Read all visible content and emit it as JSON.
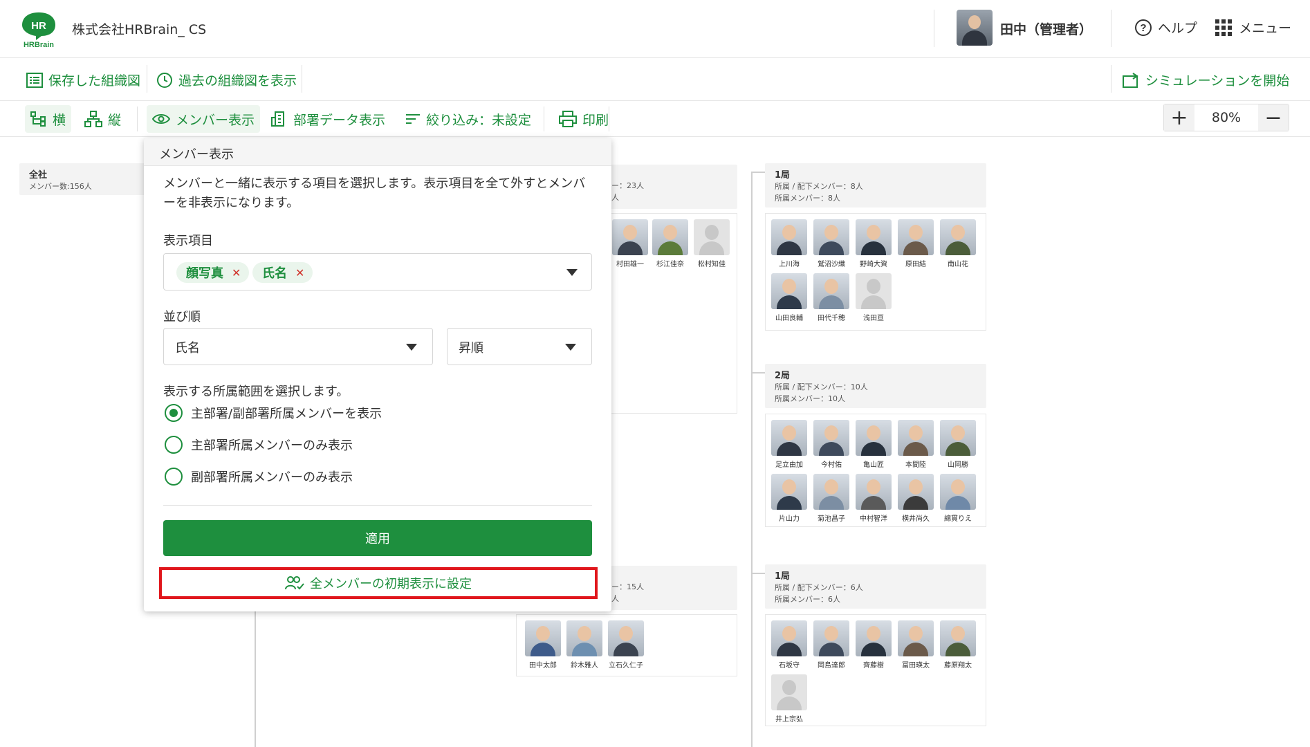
{
  "header": {
    "logo_text": "HR",
    "logo_sub": "HRBrain",
    "company": "株式会社HRBrain_ CS",
    "user": "田中（管理者）",
    "help": "ヘルプ",
    "menu": "メニュー"
  },
  "subbar": {
    "saved": "保存した組織図",
    "past": "過去の組織図を表示",
    "simulation": "シミュレーションを開始"
  },
  "toolbar": {
    "horizontal": "横",
    "vertical": "縦",
    "member_display": "メンバー表示",
    "dept_data": "部署データ表示",
    "filter": "絞り込み：未設定",
    "print": "印刷",
    "zoom": "80%"
  },
  "popup": {
    "title": "メンバー表示",
    "description": "メンバーと一緒に表示する項目を選択します。表示項目を全て外すとメンバーを非表示になります。",
    "items_label": "表示項目",
    "chips": [
      "顔写真",
      "氏名"
    ],
    "sort_label": "並び順",
    "sort_field": "氏名",
    "sort_order": "昇順",
    "scope_label": "表示する所属範囲を選択します。",
    "scope_options": [
      "主部署/副部署所属メンバーを表示",
      "主部署所属メンバーのみ表示",
      "副部署所属メンバーのみ表示"
    ],
    "selected_scope": 0,
    "apply": "適用",
    "reset": "全メンバーの初期表示に設定"
  },
  "org": {
    "root": {
      "title": "全社",
      "sub": "メンバー数:156人"
    },
    "partial_top": {
      "line1": "ー：23人",
      "line2": "人"
    },
    "partial_bottom": {
      "line1": "ー：15人",
      "line2": "人"
    },
    "partial_top_members": [
      "村田雄一",
      "杉江佳奈",
      "松村知佳"
    ],
    "bureau1": {
      "title": "1局",
      "line1": "所属 / 配下メンバー：8人",
      "line2": "所属メンバー：8人",
      "members": [
        "上川海",
        "鷲沼沙織",
        "野崎大資",
        "原田結",
        "南山花",
        "山田良輔",
        "田代千穂",
        "浅田亘"
      ]
    },
    "bureau2": {
      "title": "2局",
      "line1": "所属 / 配下メンバー：10人",
      "line2": "所属メンバー：10人",
      "members": [
        "足立由加",
        "今村佑",
        "亀山匠",
        "本間陸",
        "山岡勝",
        "片山力",
        "菊池昌子",
        "中村智洋",
        "横井尚久",
        "綿貫りえ"
      ]
    },
    "bottom_left_members": [
      "田中太郎",
      "鈴木雅人",
      "立石久仁子"
    ],
    "bureau3": {
      "title": "1局",
      "line1": "所属 / 配下メンバー：6人",
      "line2": "所属メンバー：6人",
      "members": [
        "石坂守",
        "岡島達郎",
        "齊藤樹",
        "冨田瑛太",
        "藤原翔太",
        "井上宗弘"
      ]
    }
  },
  "colors": {
    "accent": "#1e8f3e",
    "highlight": "#e0161c"
  }
}
